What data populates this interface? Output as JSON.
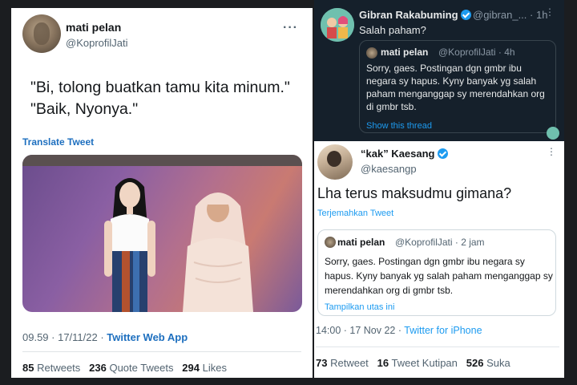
{
  "left_tweet": {
    "user_name": "mati pelan",
    "user_handle": "@KoprofilJati",
    "more": "···",
    "text_line1": "\"Bi, tolong buatkan tamu kita minum.\"",
    "text_line2": "\"Baik, Nyonya.\"",
    "translate_label": "Translate Tweet",
    "time": "09.59 · 17/11/22 · ",
    "source": "Twitter Web App",
    "retweets_count": "85",
    "retweets_label": "Retweets",
    "quotes_count": "236",
    "quotes_label": "Quote Tweets",
    "likes_count": "294",
    "likes_label": "Likes"
  },
  "reply_tweet": {
    "user_name": "Gibran Rakabuming",
    "user_handle": "@gibran_...",
    "time": "· 1h",
    "more": "⋮",
    "text": "Salah paham?",
    "quote": {
      "user_name": "mati pelan",
      "user_handle": "@KoprofilJati · 4h",
      "text": "Sorry, gaes. Postingan dgn gmbr ibu negara sy hapus. Kyny banyak yg salah paham menganggap sy merendahkan org di gmbr tsb.",
      "link": "Show this thread"
    }
  },
  "kaesang_tweet": {
    "user_name": "“kak” Kaesang",
    "user_handle": "@kaesangp",
    "more": "⋮",
    "text": "Lha terus maksudmu gimana?",
    "translate_label": "Terjemahkan Tweet",
    "quote": {
      "user_name": "mati pelan",
      "user_handle": "@KoprofilJati · 2 jam",
      "text": "Sorry, gaes. Postingan dgn gmbr ibu negara sy hapus. Kyny banyak yg salah paham menganggap sy merendahkan org di gmbr tsb.",
      "link": "Tampilkan utas ini"
    },
    "time": "14:00 · 17 Nov 22 · ",
    "source": "Twitter for iPhone",
    "retweets_count": "73",
    "retweets_label": "Retweet",
    "quotes_count": "16",
    "quotes_label": "Tweet Kutipan",
    "likes_count": "526",
    "likes_label": "Suka"
  },
  "colors": {
    "link_blue": "#1d9bf0",
    "dark_bg": "#15202b",
    "light_bg": "#ffffff"
  }
}
